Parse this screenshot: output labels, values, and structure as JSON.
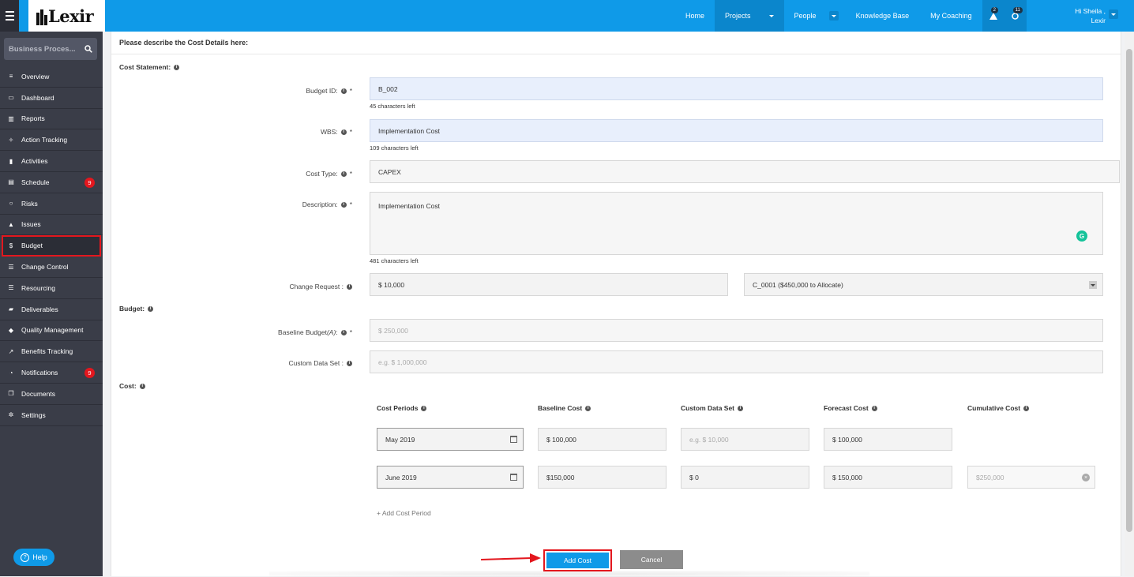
{
  "app": {
    "logo": "Lexir"
  },
  "topnav": {
    "items": [
      {
        "label": "Home"
      },
      {
        "label": "Projects"
      },
      {
        "label": "People"
      },
      {
        "label": "Knowledge Base"
      },
      {
        "label": "My Coaching"
      }
    ],
    "alerts_count": "2",
    "updates_count": "11",
    "user_line1": "Hi Sheila ,",
    "user_line2": "Lexir"
  },
  "sidebar": {
    "search_value": "Business Proces...",
    "items": [
      {
        "label": "Overview",
        "icon": "overview-icon"
      },
      {
        "label": "Dashboard",
        "icon": "dashboard-icon"
      },
      {
        "label": "Reports",
        "icon": "chart-icon"
      },
      {
        "label": "Action Tracking",
        "icon": "crosshair-icon"
      },
      {
        "label": "Activities",
        "icon": "bookmark-icon"
      },
      {
        "label": "Schedule",
        "icon": "calendar-icon",
        "badge": "9"
      },
      {
        "label": "Risks",
        "icon": "lightbulb-icon"
      },
      {
        "label": "Issues",
        "icon": "warning-icon"
      },
      {
        "label": "Budget",
        "icon": "dollar-icon"
      },
      {
        "label": "Change Control",
        "icon": "list-icon"
      },
      {
        "label": "Resourcing",
        "icon": "list-icon"
      },
      {
        "label": "Deliverables",
        "icon": "folder-icon"
      },
      {
        "label": "Quality Management",
        "icon": "tag-icon"
      },
      {
        "label": "Benefits Tracking",
        "icon": "line-chart-icon"
      },
      {
        "label": "Notifications",
        "icon": "bell-icon",
        "badge": "9"
      },
      {
        "label": "Documents",
        "icon": "documents-icon"
      },
      {
        "label": "Settings",
        "icon": "gears-icon"
      }
    ],
    "help_label": "Help"
  },
  "form": {
    "header": "Please describe the Cost Details here:",
    "cost_statement_label": "Cost Statement:",
    "budget_id": {
      "label": "Budget ID:",
      "value": "B_002",
      "hint": "45 characters left"
    },
    "wbs": {
      "label": "WBS:",
      "value": "Implementation Cost",
      "hint": "109 characters left"
    },
    "cost_type": {
      "label": "Cost Type:",
      "value": "CAPEX"
    },
    "description": {
      "label": "Description:",
      "value": "Implementation Cost",
      "hint": "481 characters left"
    },
    "change_request": {
      "label": "Change Request  :",
      "value": "$ 10,000",
      "select_value": "C_0001 ($450,000 to Allocate)"
    },
    "budget_label": "Budget:",
    "baseline_budget": {
      "label_pre": "Baseline Budget ",
      "label_em": "(A)",
      "label_post": " :",
      "placeholder": "$ 250,000"
    },
    "custom_data_set": {
      "label": "Custom Data Set  :",
      "placeholder": "e.g. $ 1,000,000"
    },
    "cost_label": "Cost:",
    "cost_table": {
      "headers": [
        "Cost Periods",
        "Baseline Cost",
        "Custom Data Set",
        "Forecast Cost",
        "Cumulative Cost"
      ],
      "rows": [
        {
          "period": "May 2019",
          "baseline": "$ 100,000",
          "custom_placeholder": "e.g. $ 10,000",
          "forecast": "$ 100,000"
        },
        {
          "period": "June 2019",
          "baseline": "$150,000",
          "custom": "$ 0",
          "forecast": "$ 150,000",
          "cumulative_placeholder": "$250,000"
        }
      ]
    },
    "add_period_label": "+ Add Cost Period",
    "add_cost_label": "Add Cost",
    "cancel_label": "Cancel"
  }
}
